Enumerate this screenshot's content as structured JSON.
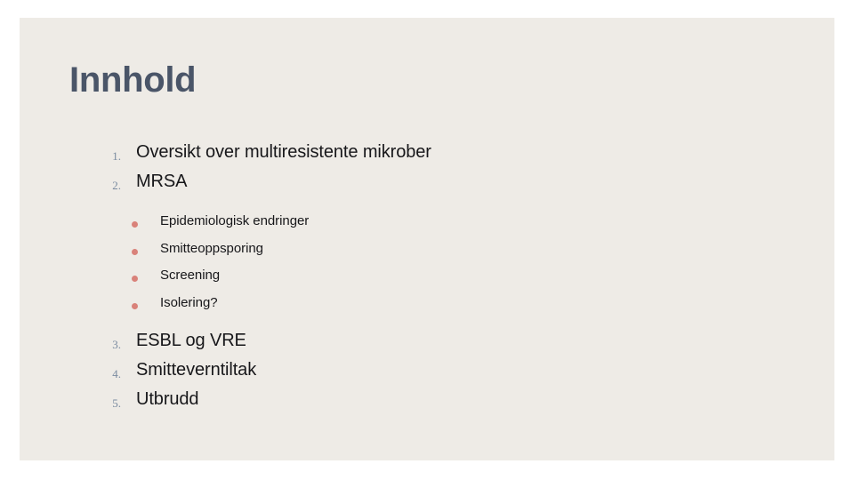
{
  "slide": {
    "title": "Innhold",
    "background_color": "#EEEBE6",
    "page_background_color": "#FFFFFF",
    "title_color": "#4A5568",
    "number_color": "#7A8BA0",
    "bullet_color": "#D9827A",
    "body_text_color": "#17171A"
  },
  "outline": {
    "items": [
      {
        "number": "1.",
        "label": "Oversikt over multiresistente mikrober"
      },
      {
        "number": "2.",
        "label": "MRSA"
      },
      {
        "number": "3.",
        "label": "ESBL og VRE"
      },
      {
        "number": "4.",
        "label": "Smitteverntiltak"
      },
      {
        "number": "5.",
        "label": "Utbrudd"
      }
    ],
    "sub_items": [
      {
        "bullet": "bullet-dot",
        "label": "Epidemiologisk endringer"
      },
      {
        "bullet": "bullet-dot",
        "label": "Smitteoppsporing"
      },
      {
        "bullet": "bullet-dot",
        "label": "Screening"
      },
      {
        "bullet": "bullet-dot",
        "label": "Isolering?"
      }
    ]
  }
}
